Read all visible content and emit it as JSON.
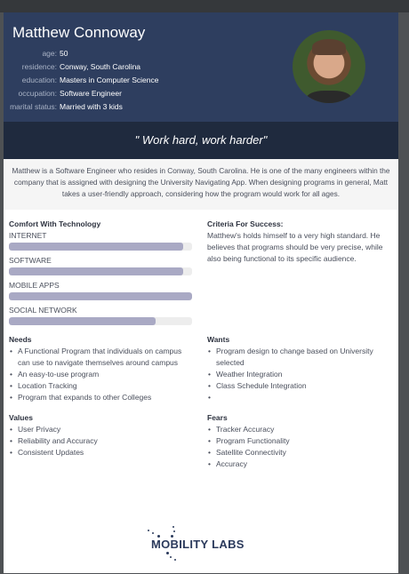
{
  "profile": {
    "name": "Matthew Connoway",
    "facts": [
      {
        "label": "age:",
        "value": "50"
      },
      {
        "label": "residence:",
        "value": "Conway, South Carolina"
      },
      {
        "label": "education:",
        "value": "Masters in Computer Science"
      },
      {
        "label": "occupation:",
        "value": "Software Engineer"
      },
      {
        "label": "marital status:",
        "value": "Married with 3 kids"
      }
    ]
  },
  "quote": "\" Work hard, work harder\"",
  "summary": "Matthew is a Software Engineer who resides in Conway, South Carolina. He is one of the many engineers within the company that is assigned with designing the University Navigating App. When designing programs in general, Matt takes a user-friendly approach, considering how the program would work for all ages.",
  "comfort": {
    "title": "Comfort With Technology",
    "items": [
      {
        "label": "INTERNET",
        "percent": 95
      },
      {
        "label": "SOFTWARE",
        "percent": 95
      },
      {
        "label": "MOBILE APPS",
        "percent": 100
      },
      {
        "label": "SOCIAL NETWORK",
        "percent": 80
      }
    ]
  },
  "criteria": {
    "title": "Criteria For Success:",
    "text": "Matthew's holds himself to a very high standard. He believes that programs should be very precise, while also being functional to its specific audience."
  },
  "needs": {
    "title": "Needs",
    "items": [
      "A Functional Program that individuals on campus can use to navigate themselves around campus",
      "An easy-to-use program",
      "Location Tracking",
      "Program that expands to other Colleges"
    ]
  },
  "wants": {
    "title": "Wants",
    "items": [
      "Program design to change based on University selected",
      "Weather Integration",
      "Class Schedule Integration",
      ""
    ]
  },
  "values": {
    "title": "Values",
    "items": [
      "User Privacy",
      "Reliability and Accuracy",
      "Consistent Updates"
    ]
  },
  "fears": {
    "title": "Fears",
    "items": [
      "Tracker Accuracy",
      "Program Functionality",
      "Satellite Connectivity",
      "Accuracy"
    ]
  },
  "logo": {
    "text": "MOBILITY LABS"
  },
  "colors": {
    "header": "#2e3e5f",
    "quote": "#1f2a3e",
    "bar": "#a9a9c4"
  }
}
